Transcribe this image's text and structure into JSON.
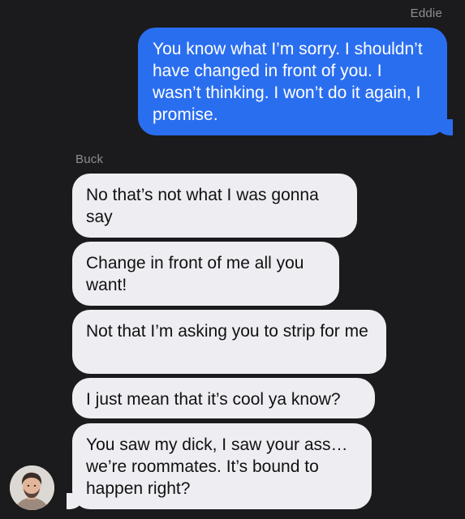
{
  "conversation": {
    "outgoing_sender": "Eddie",
    "incoming_sender": "Buck",
    "messages": [
      {
        "from": "Eddie",
        "text": "You know what I’m sorry. I shouldn’t have changed in front of you. I wasn’t thinking. I won’t do it again, I promise."
      },
      {
        "from": "Buck",
        "text": "No that’s not what I was gonna say"
      },
      {
        "from": "Buck",
        "text": "Change in front of me all you want!"
      },
      {
        "from": "Buck",
        "text": "Not that I’m asking you to strip for me"
      },
      {
        "from": "Buck",
        "text": "I just mean that it’s cool ya know?"
      },
      {
        "from": "Buck",
        "text": "You saw my dick, I saw your ass… we’re roommates. It’s bound to happen right?"
      }
    ]
  },
  "colors": {
    "background": "#1b1b1d",
    "outgoing_bubble": "#2a6ef0",
    "incoming_bubble": "#eeeef2",
    "sender_name": "#8e8e93"
  },
  "icons": {
    "avatar": "contact-avatar-photo"
  }
}
